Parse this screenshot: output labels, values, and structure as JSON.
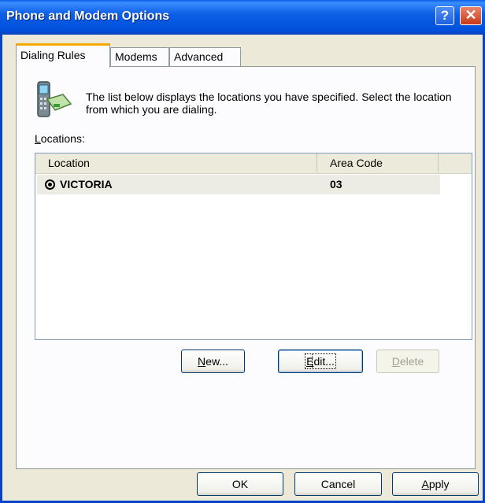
{
  "window": {
    "title": "Phone and Modem Options"
  },
  "tabs": [
    {
      "label": "Dialing Rules",
      "active": true
    },
    {
      "label": "Modems",
      "active": false
    },
    {
      "label": "Advanced",
      "active": false
    }
  ],
  "intro_text": "The list below displays the locations you have specified. Select the location from which you are dialing.",
  "locations_label": {
    "mnemonic": "L",
    "rest": "ocations:"
  },
  "table": {
    "columns": [
      "Location",
      "Area Code"
    ],
    "rows": [
      {
        "location": "VICTORIA",
        "area_code": "03",
        "selected": true
      }
    ]
  },
  "buttons": {
    "new": {
      "mnemonic": "N",
      "rest": "ew..."
    },
    "edit": {
      "mnemonic": "E",
      "rest": "dit..."
    },
    "delete": {
      "mnemonic": "D",
      "rest": "elete"
    },
    "ok": "OK",
    "cancel": "Cancel",
    "apply": {
      "mnemonic": "A",
      "rest": "pply"
    }
  },
  "icons": [
    "help-icon",
    "close-icon",
    "phone-modem-icon",
    "radio-selected-icon"
  ]
}
